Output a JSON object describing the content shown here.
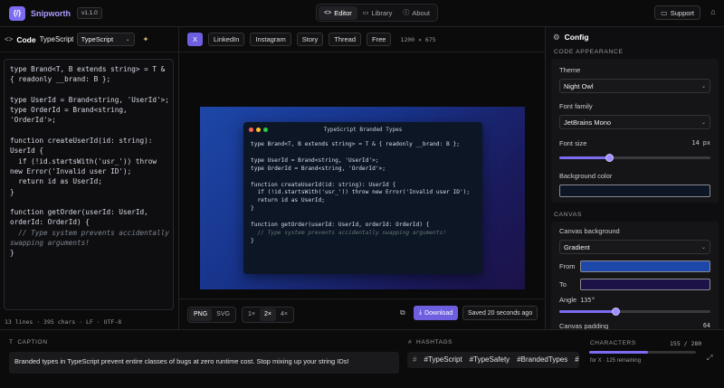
{
  "app": {
    "logo_text": "{/}",
    "name": "Snipworth",
    "version": "v1.1.0"
  },
  "nav": [
    {
      "icon": "code-icon",
      "glyph": "<>",
      "label": "Editor",
      "active": true
    },
    {
      "icon": "library-icon",
      "glyph": "▭",
      "label": "Library",
      "active": false
    },
    {
      "icon": "info-icon",
      "glyph": "ⓘ",
      "label": "About",
      "active": false
    }
  ],
  "header": {
    "support_label": "Support",
    "notifications_glyph": "⌂"
  },
  "code_panel": {
    "icon_glyph": "<>",
    "title": "Code",
    "snippet_title": "TypeScript Branded Types",
    "language": "TypeScript",
    "magic_glyph": "✦",
    "status": "13 lines · 395 chars · LF · UTF-8",
    "lines": [
      "type Brand<T, B extends string> = T &",
      "{ readonly __brand: B };",
      "",
      "type UserId = Brand<string, 'UserId'>;",
      "type OrderId = Brand<string,",
      "'OrderId'>;",
      "",
      "function createUserId(id: string):",
      "UserId {",
      "  if (!id.startsWith('usr_')) throw",
      "new Error('Invalid user ID');",
      "  return id as UserId;",
      "}",
      "",
      "function getOrder(userId: UserId,",
      "orderId: OrderId) {",
      "  // Type system prevents accidentally",
      "swapping arguments!",
      "}"
    ]
  },
  "platforms": [
    {
      "label": "X",
      "active": true
    },
    {
      "label": "LinkedIn",
      "active": false
    },
    {
      "label": "Instagram",
      "active": false
    },
    {
      "label": "Story",
      "active": false
    },
    {
      "label": "Thread",
      "active": false
    },
    {
      "label": "Free",
      "active": false
    }
  ],
  "canvas_dims": "1200 × 675",
  "preview": {
    "window_title": "TypeScript Branded Types",
    "dot_colors": [
      "#ff5f56",
      "#ffbd2e",
      "#27c93f"
    ],
    "lines": [
      "type Brand<T, B extends string> = T & { readonly __brand: B };",
      "",
      "type UserId = Brand<string, 'UserId'>;",
      "type OrderId = Brand<string, 'OrderId'>;",
      "",
      "function createUserId(id: string): UserId {",
      "  if (!id.startsWith('usr_')) throw new Error('Invalid user ID');",
      "  return id as UserId;",
      "}",
      "",
      "function getOrder(userId: UserId, orderId: OrderId) {",
      "  // Type system prevents accidentally swapping arguments!",
      "}"
    ]
  },
  "export": {
    "formats": [
      {
        "label": "PNG",
        "active": true
      },
      {
        "label": "SVG",
        "active": false
      }
    ],
    "scales": [
      {
        "label": "1×",
        "active": false
      },
      {
        "label": "2×",
        "active": true
      },
      {
        "label": "4×",
        "active": false
      }
    ],
    "download_label": "Download",
    "saved_label": "Saved 20 seconds ago"
  },
  "config": {
    "title": "Config",
    "code_appearance_label": "CODE APPEARANCE",
    "theme_label": "Theme",
    "theme_value": "Night Owl",
    "font_family_label": "Font family",
    "font_family_value": "JetBrains Mono",
    "font_size_label": "Font size",
    "font_size_value": "14 px",
    "font_size_fraction": 0.33,
    "background_color_label": "Background color",
    "background_color": "#0d1624",
    "canvas_label": "CANVAS",
    "canvas_bg_label": "Canvas background",
    "canvas_bg_value": "Gradient",
    "from_label": "From",
    "from_color": "#1d47a8",
    "to_label": "To",
    "to_color": "#1c1248",
    "angle_label": "Angle",
    "angle_value": "135°",
    "angle_fraction": 0.37,
    "padding_label": "Canvas padding",
    "padding_value": "64"
  },
  "caption": {
    "label": "CAPTION",
    "text": "Branded types in TypeScript prevent entire classes of bugs at zero runtime cost. Stop mixing up your string IDs!"
  },
  "hashtags": {
    "label": "HASHTAGS",
    "tags": [
      "#TypeScript",
      "#TypeSafety",
      "#BrandedTypes",
      "#Tip"
    ]
  },
  "characters": {
    "label": "CHARACTERS",
    "count": "155 / 280",
    "fraction": 0.55,
    "note": "for X · 125 remaining"
  },
  "colors": {
    "accent": "#6e5fe0",
    "brand": "#a99cff"
  }
}
